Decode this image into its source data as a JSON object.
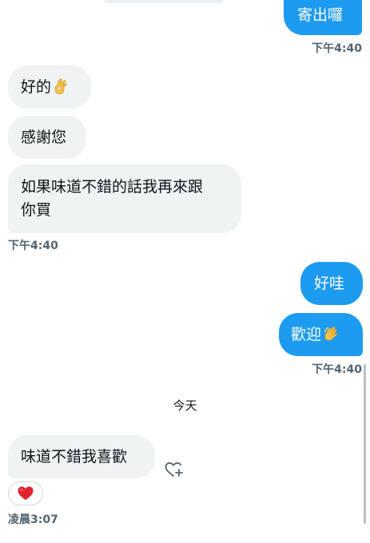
{
  "messages": {
    "m1": "寄出囉",
    "t1": "下午4:40",
    "m2": "好的",
    "m3": "感謝您",
    "m4_line1": "如果味道不錯的話我再來跟",
    "m4_line2": "你買",
    "t2": "下午4:40",
    "m5": "好哇",
    "m6": "歡迎",
    "t3": "下午4:40",
    "day": "今天",
    "m7": "味道不錯我喜歡",
    "t4": "凌晨3:07"
  },
  "icons": {
    "ok_hand": "ok-hand-emoji",
    "clap": "clapping-hands-emoji",
    "heart": "red-heart-emoji",
    "add_reaction": "heart-plus-icon"
  },
  "colors": {
    "outgoing": "#1d9bf0",
    "incoming": "#eff3f4",
    "timestamp": "#536471"
  }
}
